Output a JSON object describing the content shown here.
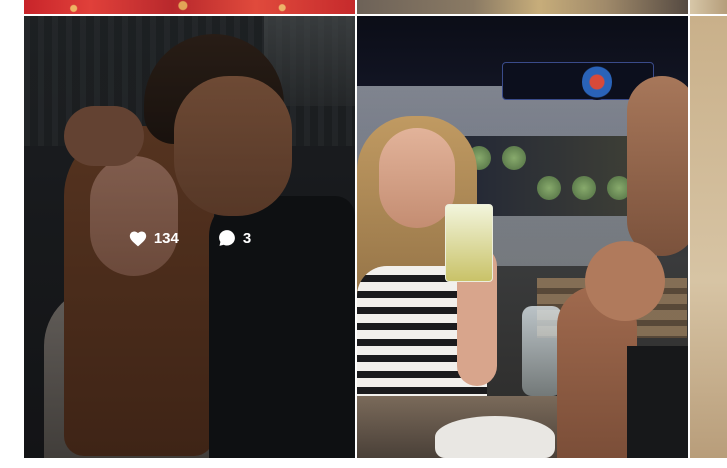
{
  "grid": {
    "hovered_post": {
      "likes": "134",
      "comments": "3",
      "like_icon": "heart-icon",
      "comment_icon": "comment-icon"
    }
  },
  "colors": {
    "overlay": "#000000",
    "stat_text": "#ffffff",
    "background": "#ffffff"
  }
}
